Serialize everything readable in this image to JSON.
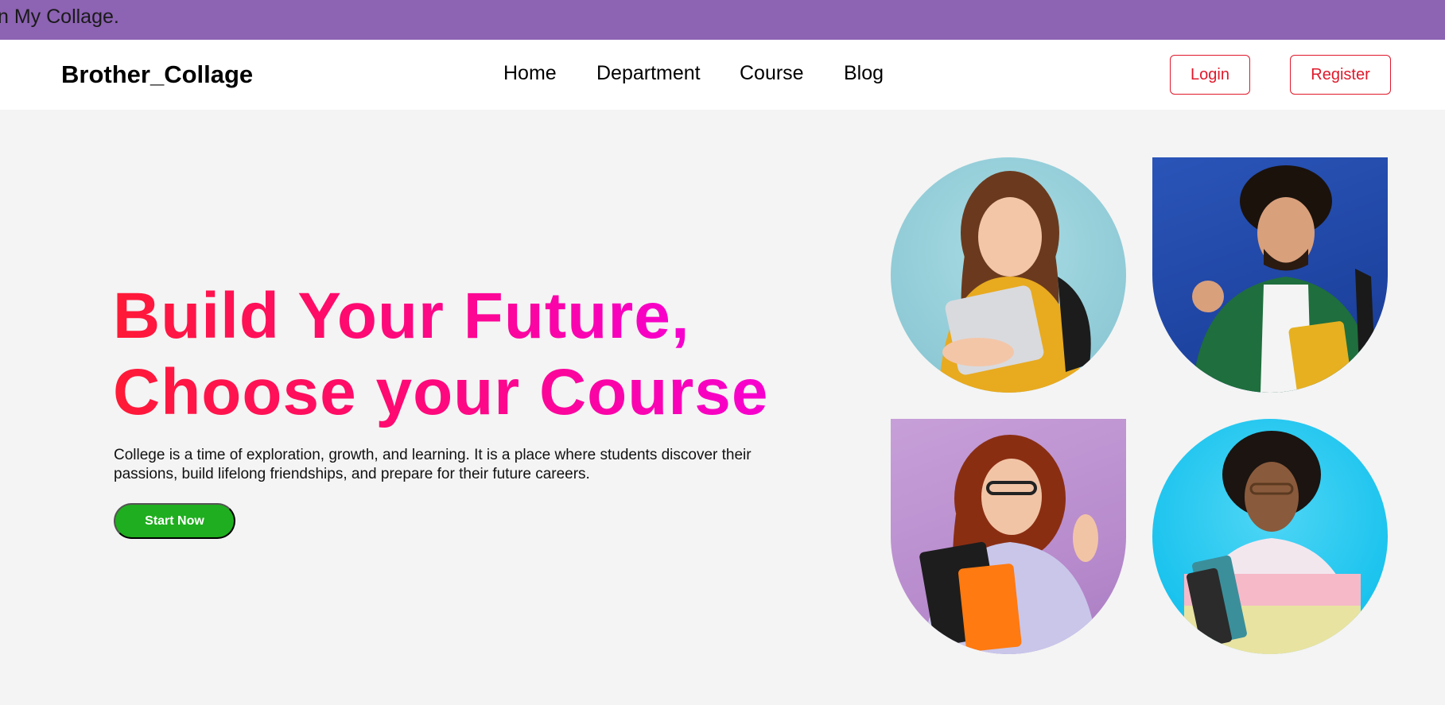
{
  "announcement": {
    "text": "n My Collage."
  },
  "header": {
    "brand": "Brother_Collage",
    "nav": [
      {
        "label": "Home"
      },
      {
        "label": "Department"
      },
      {
        "label": "Course"
      },
      {
        "label": "Blog"
      }
    ],
    "login_label": "Login",
    "register_label": "Register"
  },
  "hero": {
    "title_line1": "Build Your Future,",
    "title_line2": "Choose your Course",
    "description": "College is a time of exploration, growth, and learning. It is a place where students discover their passions, build lifelong friendships, and prepare for their future careers.",
    "cta_label": "Start Now"
  },
  "colors": {
    "announcement_bg": "#8d63b3",
    "accent_red": "#e0182b",
    "cta_green": "#1fae1f",
    "title_gradient_start": "#ff1a35",
    "title_gradient_end": "#f700d0"
  }
}
